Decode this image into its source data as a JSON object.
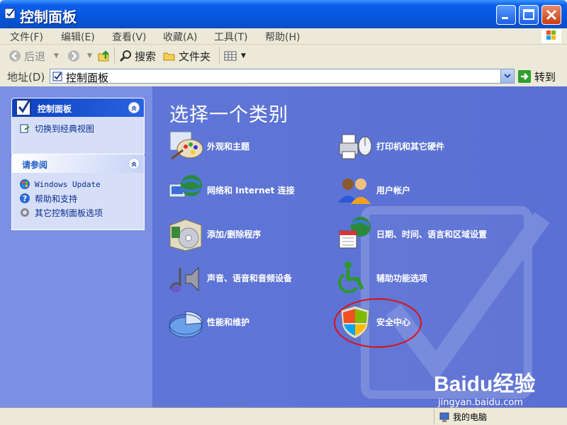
{
  "window": {
    "title": "控制面板",
    "colors": {
      "titlebar": "#0556dc",
      "content_bg": "#6179d9",
      "close": "#c83c10"
    }
  },
  "menu": [
    "文件(F)",
    "编辑(E)",
    "查看(V)",
    "收藏(A)",
    "工具(T)",
    "帮助(H)"
  ],
  "toolbar": {
    "back_label": "后退",
    "search_label": "搜索",
    "folders_label": "文件夹"
  },
  "address": {
    "label": "地址(D)",
    "value": "控制面板",
    "go_label": "转到"
  },
  "sidebar": {
    "panel1": {
      "title": "控制面板",
      "link": "切换到经典视图"
    },
    "panel2": {
      "title": "请参阅",
      "links": [
        "Windows Update",
        "帮助和支持",
        "其它控制面板选项"
      ]
    }
  },
  "main": {
    "heading": "选择一个类别",
    "categories": [
      {
        "label": "外观和主题",
        "icon": "appearance-icon"
      },
      {
        "label": "打印机和其它硬件",
        "icon": "printer-icon"
      },
      {
        "label": "网络和 Internet 连接",
        "icon": "network-icon"
      },
      {
        "label": "用户帐户",
        "icon": "users-icon"
      },
      {
        "label": "添加/删除程序",
        "icon": "add-remove-icon"
      },
      {
        "label": "日期、时间、语言和区域设置",
        "icon": "date-time-icon"
      },
      {
        "label": "声音、语音和音频设备",
        "icon": "sound-icon"
      },
      {
        "label": "辅助功能选项",
        "icon": "accessibility-icon"
      },
      {
        "label": "性能和维护",
        "icon": "performance-icon"
      },
      {
        "label": "安全中心",
        "icon": "security-shield-icon"
      }
    ]
  },
  "watermark": {
    "brand": "Baidu经验",
    "url": "jingyan.baidu.com"
  },
  "status": {
    "location": "我的电脑"
  }
}
